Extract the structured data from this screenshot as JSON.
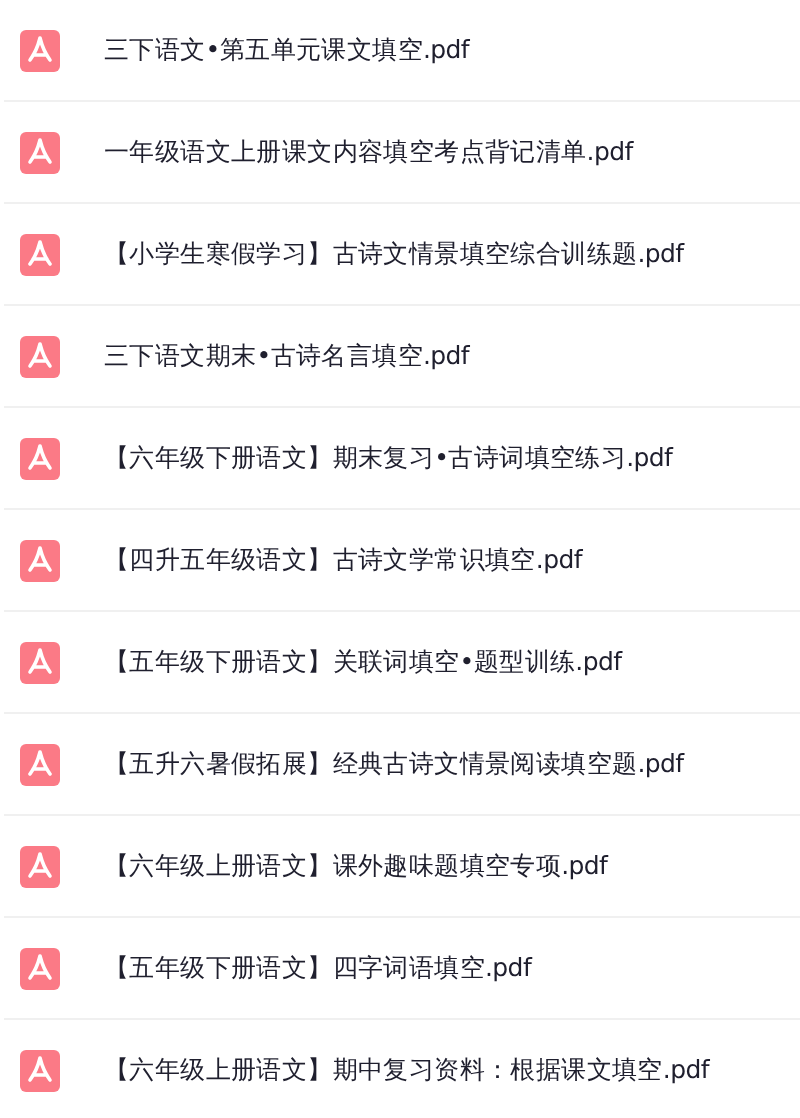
{
  "files": [
    {
      "name": "三下语文•第五单元课文填空.pdf"
    },
    {
      "name": "一年级语文上册课文内容填空考点背记清单.pdf"
    },
    {
      "name": "【小学生寒假学习】古诗文情景填空综合训练题.pdf"
    },
    {
      "name": "三下语文期末•古诗名言填空.pdf"
    },
    {
      "name": "【六年级下册语文】期末复习•古诗词填空练习.pdf"
    },
    {
      "name": "【四升五年级语文】古诗文学常识填空.pdf"
    },
    {
      "name": "【五年级下册语文】关联词填空•题型训练.pdf"
    },
    {
      "name": "【五升六暑假拓展】经典古诗文情景阅读填空题.pdf"
    },
    {
      "name": "【六年级上册语文】课外趣味题填空专项.pdf"
    },
    {
      "name": "【五年级下册语文】四字词语填空.pdf"
    },
    {
      "name": "【六年级上册语文】期中复习资料：根据课文填空.pdf"
    }
  ]
}
